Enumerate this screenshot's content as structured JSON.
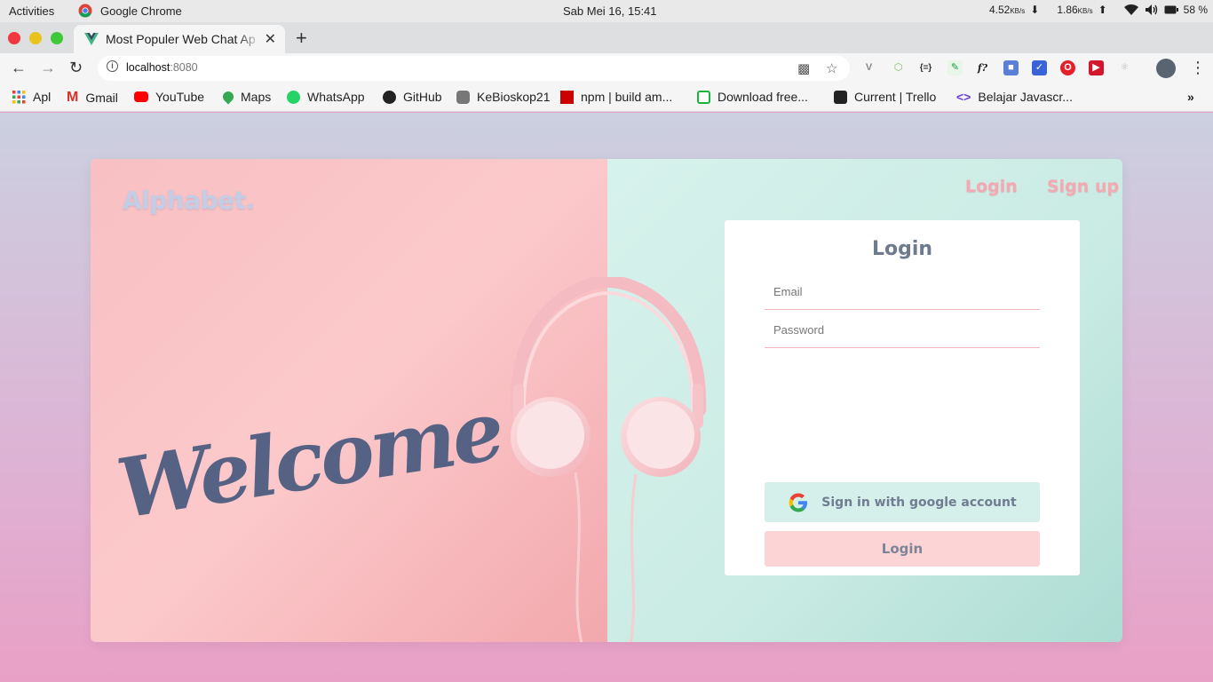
{
  "system": {
    "activities": "Activities",
    "app_name": "Google Chrome",
    "clock": "Sab Mei 16, 15:41",
    "net_down": "4.52",
    "net_down_unit": "KB/s",
    "net_up": "1.86",
    "net_up_unit": "KB/s",
    "battery": "58 %"
  },
  "browser": {
    "tab_title": "Most Populer Web Chat Ap",
    "url_host": "localhost",
    "url_port": ":8080"
  },
  "bookmarks": [
    {
      "label": "Apl",
      "icon": "apps-grid-icon"
    },
    {
      "label": "Gmail",
      "icon": "gmail-icon"
    },
    {
      "label": "YouTube",
      "icon": "youtube-icon"
    },
    {
      "label": "Maps",
      "icon": "maps-icon"
    },
    {
      "label": "WhatsApp",
      "icon": "whatsapp-icon"
    },
    {
      "label": "GitHub",
      "icon": "github-icon"
    },
    {
      "label": "KeBioskop21",
      "icon": "kebioskop-icon"
    },
    {
      "label": "npm | build am...",
      "icon": "npm-icon"
    },
    {
      "label": "Download free...",
      "icon": "download-icon"
    },
    {
      "label": "Current | Trello",
      "icon": "trello-icon"
    },
    {
      "label": "Belajar Javascr...",
      "icon": "code-icon"
    }
  ],
  "page": {
    "brand": "Alphabet.",
    "welcome": "Welcome",
    "nav_login": "Login",
    "nav_signup": "Sign up",
    "form_title": "Login",
    "email_placeholder": "Email",
    "password_placeholder": "Password",
    "google_button": "Sign in with google account",
    "login_button": "Login"
  },
  "colors": {
    "left_panel": "#fcc9cb",
    "right_panel": "#c9ebe3",
    "accent_pink": "#f4a9b2",
    "text_slate": "#556283"
  }
}
